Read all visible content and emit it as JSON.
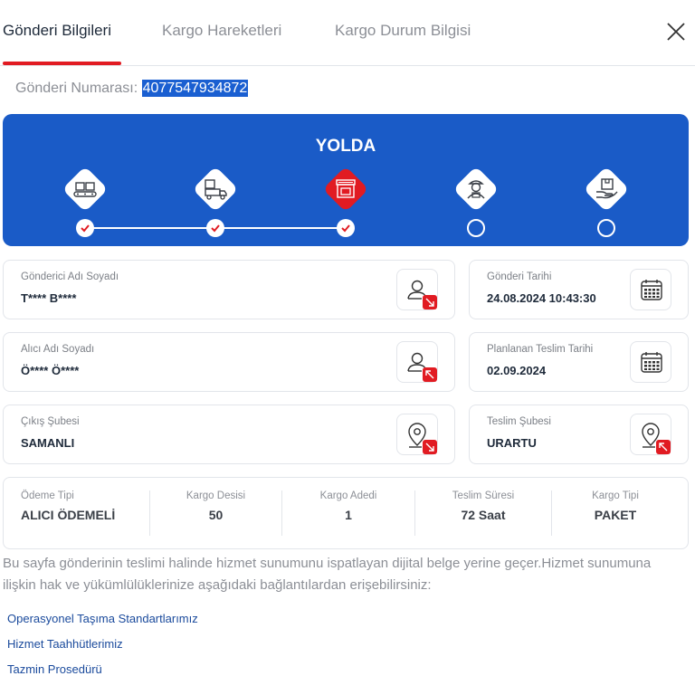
{
  "tabs": [
    {
      "label": "Gönderi Bilgileri"
    },
    {
      "label": "Kargo Hareketleri"
    },
    {
      "label": "Kargo Durum Bilgisi"
    }
  ],
  "tracking": {
    "label": "Gönderi Numarası:",
    "number": "4077547934872"
  },
  "status": {
    "title": "YOLDA",
    "completed_steps": 3,
    "total_steps": 5,
    "accent": "#e11b22",
    "banner_color": "#1a5bc7",
    "steps": [
      {
        "icon": "conveyor-boxes-icon",
        "done": true
      },
      {
        "icon": "delivery-truck-icon",
        "done": true
      },
      {
        "icon": "store-branch-icon",
        "done": true
      },
      {
        "icon": "courier-person-icon",
        "done": false
      },
      {
        "icon": "hand-package-icon",
        "done": false
      }
    ]
  },
  "sender": {
    "label": "Gönderici Adı Soyadı",
    "value": "T**** B****"
  },
  "send_date": {
    "label": "Gönderi Tarihi",
    "value": "24.08.2024 10:43:30"
  },
  "receiver": {
    "label": "Alıcı Adı Soyadı",
    "value": "Ö**** Ö****"
  },
  "planned_date": {
    "label": "Planlanan Teslim Tarihi",
    "value": "02.09.2024"
  },
  "origin_branch": {
    "label": "Çıkış Şubesi",
    "value": "SAMANLI"
  },
  "delivery_branch": {
    "label": "Teslim Şubesi",
    "value": "URARTU"
  },
  "summary": [
    {
      "label": "Ödeme Tipi",
      "value": "ALICI ÖDEMELİ"
    },
    {
      "label": "Kargo Desisi",
      "value": "50"
    },
    {
      "label": "Kargo Adedi",
      "value": "1"
    },
    {
      "label": "Teslim Süresi",
      "value": "72 Saat"
    },
    {
      "label": "Kargo Tipi",
      "value": "PAKET"
    }
  ],
  "note": "Bu sayfa gönderinin teslimi halinde hizmet sunumunu ispatlayan dijital belge yerine geçer.Hizmet sunumuna ilişkin hak ve yükümlülüklerinize aşağıdaki bağlantılardan erişebilirsiniz:",
  "links": [
    {
      "label": "Operasyonel Taşıma Standartlarımız"
    },
    {
      "label": "Hizmet Taahhütlerimiz"
    },
    {
      "label": "Tazmin Prosedürü"
    }
  ]
}
